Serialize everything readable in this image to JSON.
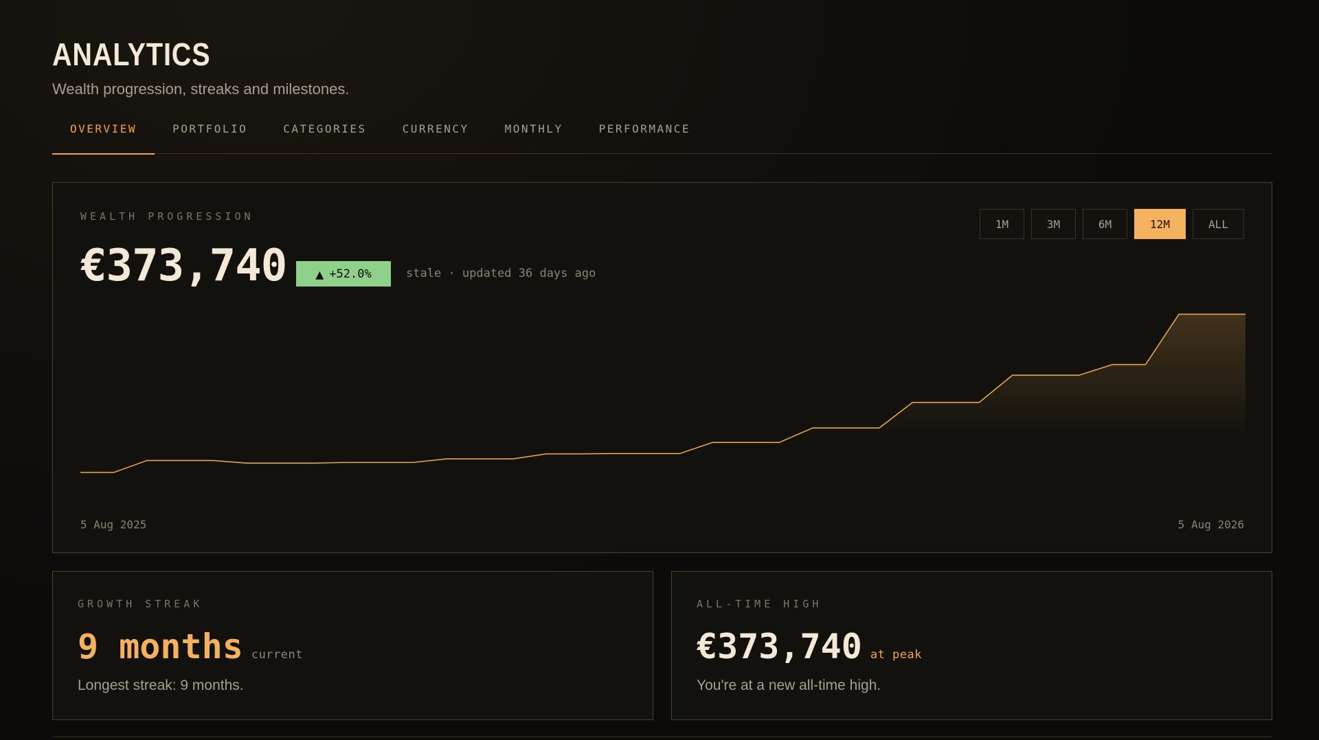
{
  "header": {
    "title": "ANALYTICS",
    "subtitle": "Wealth progression, streaks and milestones."
  },
  "tabs": [
    {
      "label": "OVERVIEW",
      "active": true
    },
    {
      "label": "PORTFOLIO",
      "active": false
    },
    {
      "label": "CATEGORIES",
      "active": false
    },
    {
      "label": "CURRENCY",
      "active": false
    },
    {
      "label": "MONTHLY",
      "active": false
    },
    {
      "label": "PERFORMANCE",
      "active": false
    }
  ],
  "wealth": {
    "label": "WEALTH PROGRESSION",
    "value": "€373,740",
    "change": "+52.0%",
    "change_icon": "triangle-up-icon",
    "status": "stale · updated 36 days ago",
    "ranges": [
      {
        "label": "1M",
        "active": false
      },
      {
        "label": "3M",
        "active": false
      },
      {
        "label": "6M",
        "active": false
      },
      {
        "label": "12M",
        "active": true
      },
      {
        "label": "ALL",
        "active": false
      }
    ],
    "start_date": "5 Aug 2025",
    "end_date": "5 Aug 2026"
  },
  "chart_data": {
    "type": "area",
    "series": [
      {
        "values": [
          245800,
          245800,
          255400,
          255400,
          255400,
          253300,
          253300,
          253300,
          253900,
          253900,
          253900,
          256800,
          256800,
          256800,
          260800,
          260800,
          261000,
          261000,
          261000,
          270100,
          270100,
          270100,
          281800,
          281800,
          281800,
          302400,
          302400,
          302400,
          324400,
          324400,
          324400,
          333000,
          333000,
          373740,
          373740,
          373740
        ]
      }
    ],
    "x_start": "5 Aug 2025",
    "x_end": "5 Aug 2026",
    "ylim": [
      230000,
      380000
    ],
    "grid": false,
    "colors": {
      "line": "#e6a44e",
      "fill": "#e6a44e"
    }
  },
  "streak": {
    "label": "GROWTH STREAK",
    "value": "9 months",
    "suffix": "current",
    "description": "Longest streak: 9 months."
  },
  "ath": {
    "label": "ALL-TIME HIGH",
    "value": "€373,740",
    "suffix": "at peak",
    "description": "You're at a new all-time high."
  },
  "colors": {
    "accent": "#f0a44a",
    "positive": "#8fd18a",
    "background": "#0c0b09"
  }
}
